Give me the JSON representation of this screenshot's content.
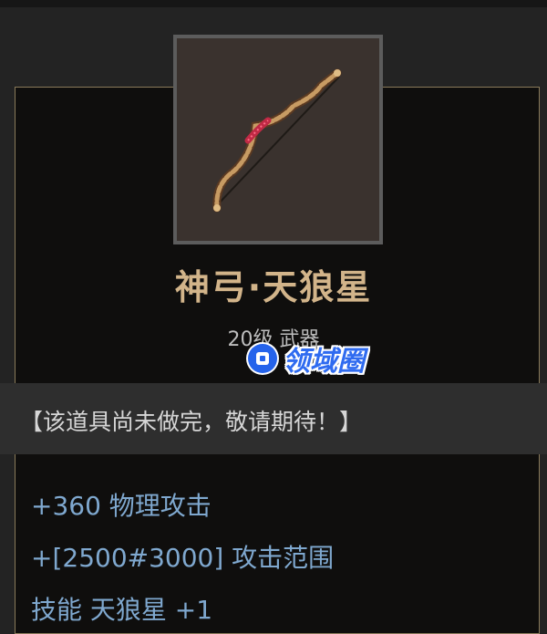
{
  "item": {
    "icon": "bow-icon",
    "name": "神弓·天狼星",
    "meta": "20级 武器"
  },
  "notice": "【该道具尚未做完，敬请期待！】",
  "stats": [
    "+360 物理攻击",
    "+[2500#3000] 攻击范围",
    "技能 天狼星 +1"
  ],
  "watermark": {
    "text": "领域圈"
  },
  "colors": {
    "name": "#d2b48a",
    "stat": "#7fa8cf",
    "border": "#8a7a5a",
    "watermark": "#2f6bf0"
  }
}
